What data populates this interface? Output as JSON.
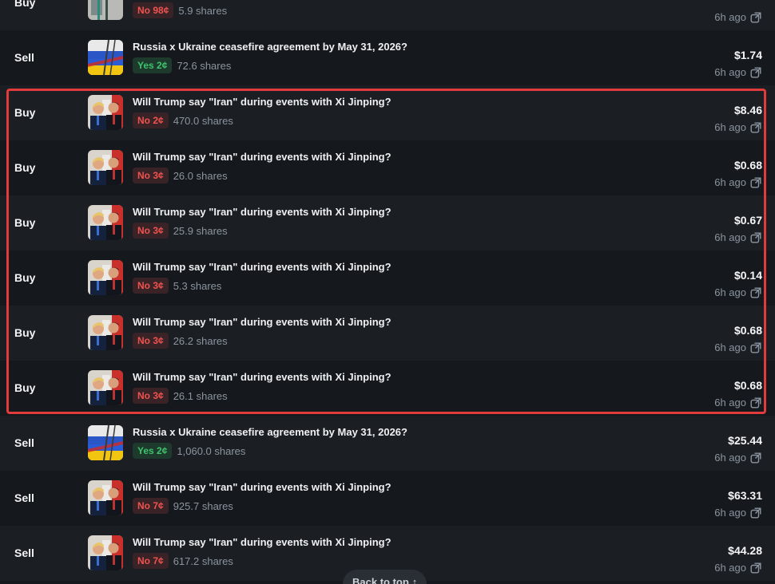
{
  "colors": {
    "highlight": "#e23b3b",
    "no": "#ef5350",
    "yes": "#3ec46d"
  },
  "back_to_top": {
    "label": "Back to top",
    "icon": "arrow-up-icon",
    "arrow": "↑"
  },
  "rows": [
    {
      "side": "Buy",
      "market": "",
      "image": "wall-thumbnail",
      "outcome": "No",
      "price": "98¢",
      "shares": "5.9 shares",
      "amount": "",
      "time": "6h ago"
    },
    {
      "side": "Sell",
      "market": "Russia x Ukraine ceasefire agreement by May 31, 2026?",
      "image": "russia-ukraine-flag-thumbnail",
      "outcome": "Yes",
      "price": "2¢",
      "shares": "72.6 shares",
      "amount": "$1.74",
      "time": "6h ago"
    },
    {
      "side": "Buy",
      "market": "Will Trump say \"Iran\" during events with Xi Jinping?",
      "image": "trump-xi-thumbnail",
      "outcome": "No",
      "price": "2¢",
      "shares": "470.0 shares",
      "amount": "$8.46",
      "time": "6h ago"
    },
    {
      "side": "Buy",
      "market": "Will Trump say \"Iran\" during events with Xi Jinping?",
      "image": "trump-xi-thumbnail",
      "outcome": "No",
      "price": "3¢",
      "shares": "26.0 shares",
      "amount": "$0.68",
      "time": "6h ago"
    },
    {
      "side": "Buy",
      "market": "Will Trump say \"Iran\" during events with Xi Jinping?",
      "image": "trump-xi-thumbnail",
      "outcome": "No",
      "price": "3¢",
      "shares": "25.9 shares",
      "amount": "$0.67",
      "time": "6h ago"
    },
    {
      "side": "Buy",
      "market": "Will Trump say \"Iran\" during events with Xi Jinping?",
      "image": "trump-xi-thumbnail",
      "outcome": "No",
      "price": "3¢",
      "shares": "5.3 shares",
      "amount": "$0.14",
      "time": "6h ago"
    },
    {
      "side": "Buy",
      "market": "Will Trump say \"Iran\" during events with Xi Jinping?",
      "image": "trump-xi-thumbnail",
      "outcome": "No",
      "price": "3¢",
      "shares": "26.2 shares",
      "amount": "$0.68",
      "time": "6h ago"
    },
    {
      "side": "Buy",
      "market": "Will Trump say \"Iran\" during events with Xi Jinping?",
      "image": "trump-xi-thumbnail",
      "outcome": "No",
      "price": "3¢",
      "shares": "26.1 shares",
      "amount": "$0.68",
      "time": "6h ago"
    },
    {
      "side": "Sell",
      "market": "Russia x Ukraine ceasefire agreement by May 31, 2026?",
      "image": "russia-ukraine-flag-thumbnail",
      "outcome": "Yes",
      "price": "2¢",
      "shares": "1,060.0 shares",
      "amount": "$25.44",
      "time": "6h ago"
    },
    {
      "side": "Sell",
      "market": "Will Trump say \"Iran\" during events with Xi Jinping?",
      "image": "trump-xi-thumbnail",
      "outcome": "No",
      "price": "7¢",
      "shares": "925.7 shares",
      "amount": "$63.31",
      "time": "6h ago"
    },
    {
      "side": "Sell",
      "market": "Will Trump say \"Iran\" during events with Xi Jinping?",
      "image": "trump-xi-thumbnail",
      "outcome": "No",
      "price": "7¢",
      "shares": "617.2 shares",
      "amount": "$44.28",
      "time": "6h ago"
    }
  ]
}
